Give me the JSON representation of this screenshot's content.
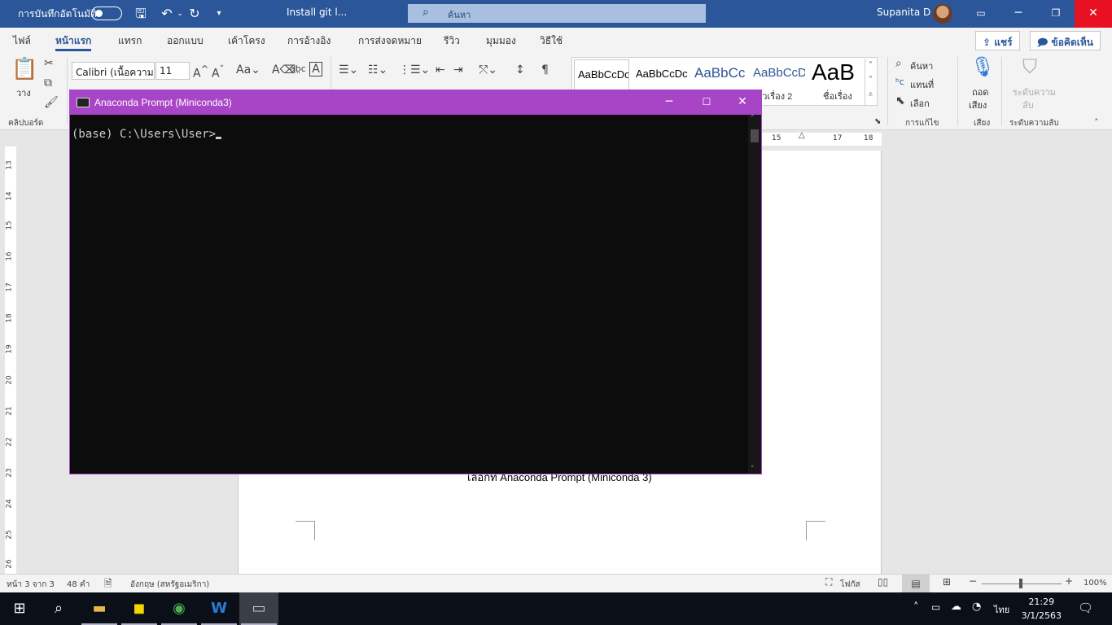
{
  "titlebar": {
    "autosave_label": "การบันทึกอัตโนมัติ",
    "doc_title": "Install git l...",
    "search_placeholder": "ค้นหา",
    "user_name": "Supanita D"
  },
  "tabs": [
    "ไฟล์",
    "หน้าแรก",
    "แทรก",
    "ออกแบบ",
    "เค้าโครง",
    "การอ้างอิง",
    "การส่งจดหมาย",
    "รีวิว",
    "มุมมอง",
    "วิธีใช้"
  ],
  "share_label": "แชร์",
  "comments_label": "ข้อคิดเห็น",
  "ribbon": {
    "paste_label": "วาง",
    "clipboard_label": "คลิปบอร์ด",
    "font_name": "Calibri (เนื้อความ)",
    "font_size": "11",
    "styles": [
      {
        "preview": "AaBbCcDc",
        "caption": ""
      },
      {
        "preview": "AaBbCcDc",
        "caption": ""
      },
      {
        "preview": "AaBbCc",
        "caption": ""
      },
      {
        "preview": "AaBbCcD",
        "caption": "หัวเรื่อง 2"
      },
      {
        "preview": "AaB",
        "caption": "ชื่อเรื่อง"
      }
    ],
    "find_label": "ค้นหา",
    "replace_label": "แทนที่",
    "select_label": "เลือก",
    "editing_label": "การแก้ไข",
    "dictate_label": "ถอด",
    "dictate_label2": "เสียง",
    "voice_label": "เสียง",
    "sensitivity_label": "ระดับความ",
    "sensitivity_label2": "ลับ",
    "sensitivity_group": "ระดับความลับ"
  },
  "hruler": {
    "marks": [
      "15",
      "17",
      "18"
    ]
  },
  "vruler": {
    "marks": [
      "13",
      "14",
      "15",
      "16",
      "17",
      "18",
      "19",
      "20",
      "21",
      "22",
      "23",
      "24",
      "25",
      "26"
    ]
  },
  "document": {
    "caption_text": "เลือกที่ Anaconda Prompt (Miniconda 3)"
  },
  "console": {
    "title": "Anaconda Prompt (Miniconda3)",
    "prompt": "(base) C:\\Users\\User>"
  },
  "statusbar": {
    "page": "หน้า 3 จาก 3",
    "words": "48 คำ",
    "language": "อังกฤษ (สหรัฐอเมริกา)",
    "focus": "โฟกัส",
    "zoom": "100%"
  },
  "taskbar": {
    "lang": "ไทย",
    "time": "21:29",
    "date": "3/1/2563"
  }
}
